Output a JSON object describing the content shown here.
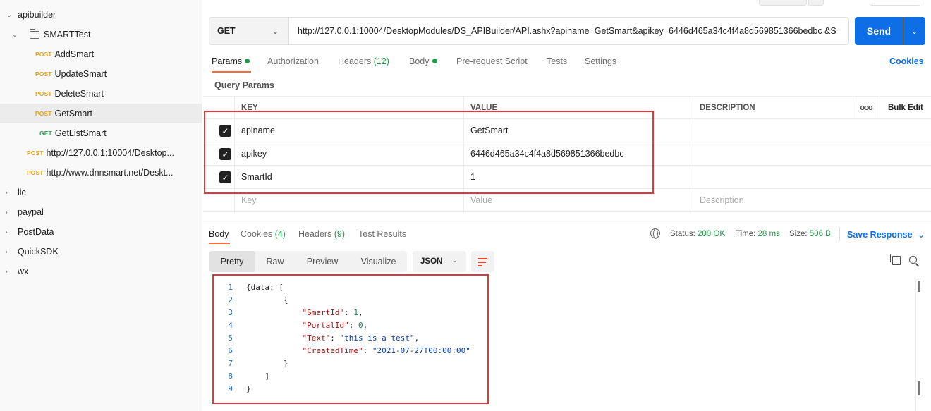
{
  "sidebar": {
    "collection": "apibuilder",
    "folder": "SMARTTest",
    "requests": [
      {
        "method": "POST",
        "name": "AddSmart"
      },
      {
        "method": "POST",
        "name": "UpdateSmart"
      },
      {
        "method": "POST",
        "name": "DeleteSmart"
      },
      {
        "method": "POST",
        "name": "GetSmart"
      },
      {
        "method": "GET",
        "name": "GetListSmart"
      }
    ],
    "loose_requests": [
      {
        "method": "POST",
        "name": "http://127.0.0.1:10004/Desktop..."
      },
      {
        "method": "POST",
        "name": "http://www.dnnsmart.net/Deskt..."
      }
    ],
    "collections": [
      "lic",
      "paypal",
      "PostData",
      "QuickSDK",
      "wx"
    ]
  },
  "request": {
    "method": "GET",
    "url": "http://127.0.0.1:10004/DesktopModules/DS_APIBuilder/API.ashx?apiname=GetSmart&apikey=6446d465a34c4f4a8d569851366bedbc &S",
    "send_label": "Send"
  },
  "request_tabs": {
    "params": "Params",
    "authorization": "Authorization",
    "headers": "Headers",
    "headers_count": "(12)",
    "body": "Body",
    "prerequest": "Pre-request Script",
    "tests": "Tests",
    "settings": "Settings",
    "cookies": "Cookies"
  },
  "query_params": {
    "title": "Query Params",
    "headers": {
      "key": "KEY",
      "value": "VALUE",
      "description": "DESCRIPTION",
      "bulk_edit": "Bulk Edit"
    },
    "rows": [
      {
        "key": "apiname",
        "value": "GetSmart",
        "description": ""
      },
      {
        "key": "apikey",
        "value": "6446d465a34c4f4a8d569851366bedbc",
        "description": ""
      },
      {
        "key": "SmartId",
        "value": "1",
        "description": ""
      }
    ],
    "placeholder": {
      "key": "Key",
      "value": "Value",
      "description": "Description"
    }
  },
  "response_tabs": {
    "body": "Body",
    "cookies": "Cookies",
    "cookies_count": "(4)",
    "headers": "Headers",
    "headers_count": "(9)",
    "test_results": "Test Results"
  },
  "response_meta": {
    "status_label": "Status:",
    "status_value": "200 OK",
    "time_label": "Time:",
    "time_value": "28 ms",
    "size_label": "Size:",
    "size_value": "506 B",
    "save_response": "Save Response"
  },
  "response_toolbar": {
    "views": [
      "Pretty",
      "Raw",
      "Preview",
      "Visualize"
    ],
    "format": "JSON"
  },
  "response_body": [
    {
      "num": "1",
      "indent": "",
      "parts": [
        {
          "t": "p",
          "v": "{data: ["
        }
      ]
    },
    {
      "num": "2",
      "indent": "        ",
      "parts": [
        {
          "t": "p",
          "v": "{"
        }
      ]
    },
    {
      "num": "3",
      "indent": "            ",
      "parts": [
        {
          "t": "k",
          "v": "\"SmartId\""
        },
        {
          "t": "p",
          "v": ": "
        },
        {
          "t": "n",
          "v": "1"
        },
        {
          "t": "p",
          "v": ","
        }
      ]
    },
    {
      "num": "4",
      "indent": "            ",
      "parts": [
        {
          "t": "k",
          "v": "\"PortalId\""
        },
        {
          "t": "p",
          "v": ": "
        },
        {
          "t": "n",
          "v": "0"
        },
        {
          "t": "p",
          "v": ","
        }
      ]
    },
    {
      "num": "5",
      "indent": "            ",
      "parts": [
        {
          "t": "k",
          "v": "\"Text\""
        },
        {
          "t": "p",
          "v": ": "
        },
        {
          "t": "s",
          "v": "\"this is a test\""
        },
        {
          "t": "p",
          "v": ","
        }
      ]
    },
    {
      "num": "6",
      "indent": "            ",
      "parts": [
        {
          "t": "k",
          "v": "\"CreatedTime\""
        },
        {
          "t": "p",
          "v": ": "
        },
        {
          "t": "s",
          "v": "\"2021-07-27T00:00:00\""
        }
      ]
    },
    {
      "num": "7",
      "indent": "        ",
      "parts": [
        {
          "t": "p",
          "v": "}"
        }
      ]
    },
    {
      "num": "8",
      "indent": "    ",
      "parts": [
        {
          "t": "p",
          "v": "]"
        }
      ]
    },
    {
      "num": "9",
      "indent": "",
      "parts": [
        {
          "t": "p",
          "v": "}"
        }
      ]
    }
  ],
  "colors": {
    "accent": "#ff6c37",
    "primary": "#0d6ee6",
    "success": "#1d9c45",
    "highlight_box": "#e0393e"
  }
}
